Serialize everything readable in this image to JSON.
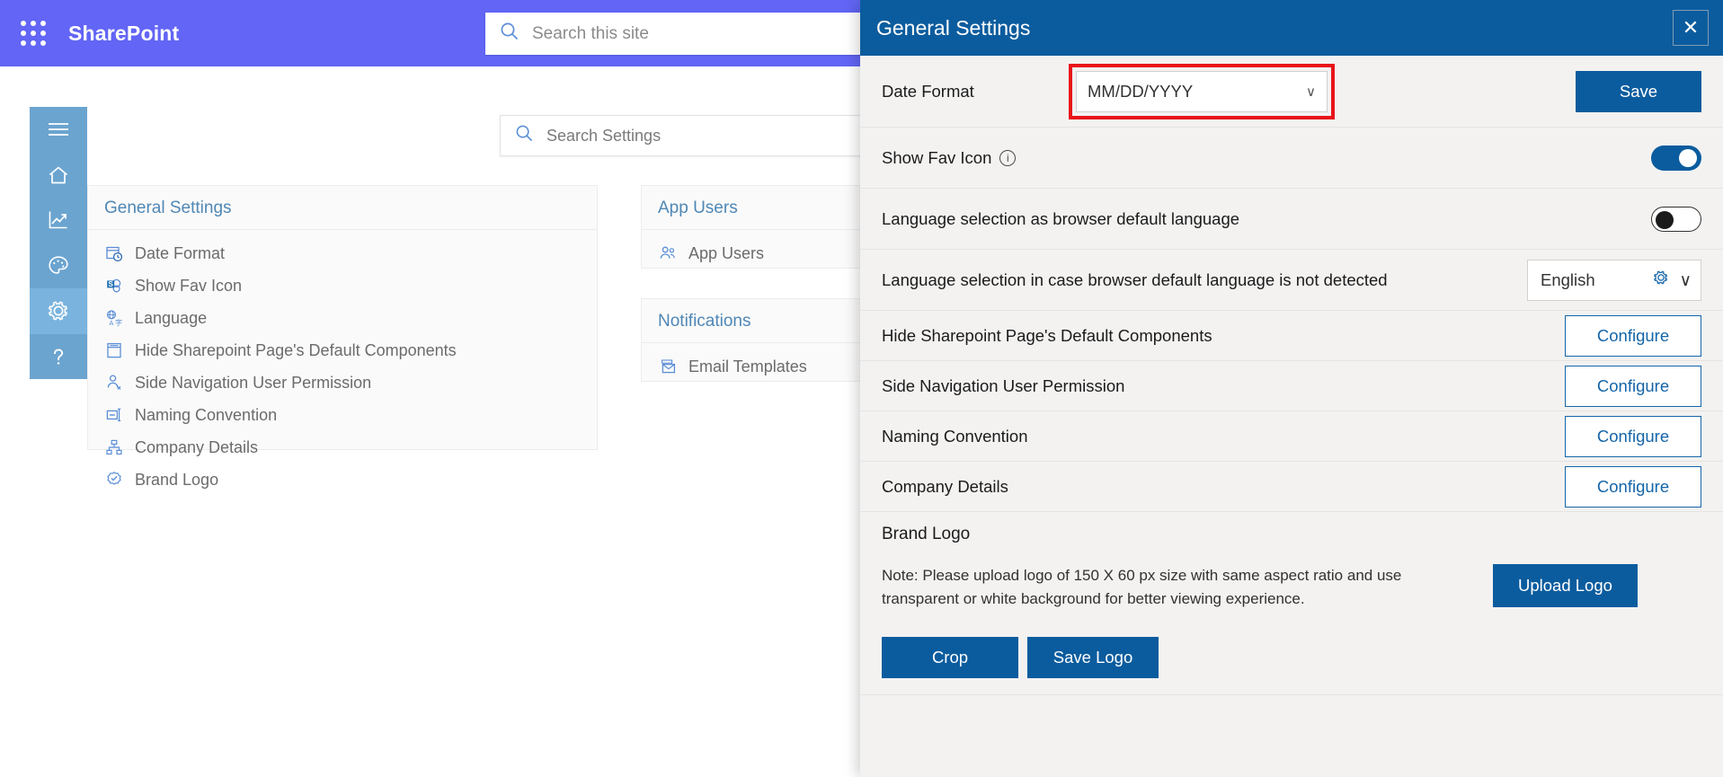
{
  "suitebar": {
    "waffle_label": "app-launcher",
    "brand": "SharePoint",
    "search_placeholder": "Search this site",
    "bg": "#6265f5"
  },
  "rail": {
    "items": [
      {
        "id": "menu",
        "icon": "hamburger-icon",
        "active": false
      },
      {
        "id": "home",
        "icon": "home-icon",
        "active": false
      },
      {
        "id": "reports",
        "icon": "chart-icon",
        "active": false
      },
      {
        "id": "theme",
        "icon": "palette-icon",
        "active": false
      },
      {
        "id": "settings",
        "icon": "gear-icon",
        "active": true
      },
      {
        "id": "help",
        "icon": "question-icon",
        "active": false
      }
    ],
    "bg": "#6ba4cf",
    "active_bg": "#79b3de"
  },
  "canvas": {
    "search_placeholder": "Search Settings",
    "groups": [
      {
        "title": "General Settings",
        "items": [
          {
            "label": "Date Format",
            "icon": "calendar-clock-icon"
          },
          {
            "label": "Show Fav Icon",
            "icon": "favicon-icon"
          },
          {
            "label": "Language",
            "icon": "language-icon"
          },
          {
            "label": "Hide Sharepoint Page's Default Components",
            "icon": "page-layout-icon"
          },
          {
            "label": "Side Navigation User Permission",
            "icon": "user-permission-icon"
          },
          {
            "label": "Naming Convention",
            "icon": "naming-icon"
          },
          {
            "label": "Company Details",
            "icon": "org-chart-icon"
          },
          {
            "label": "Brand Logo",
            "icon": "badge-icon"
          }
        ]
      },
      {
        "title": "App Users",
        "items": [
          {
            "label": "App Users",
            "icon": "people-icon"
          }
        ]
      },
      {
        "title": "Notifications",
        "items": [
          {
            "label": "Email Templates",
            "icon": "email-template-icon"
          }
        ]
      }
    ]
  },
  "panel": {
    "title": "General Settings",
    "close_label": "✕",
    "header_bg": "#0b5c9e",
    "highlight_color": "#e8151a",
    "rows": {
      "date_format": {
        "label": "Date Format",
        "value": "MM/DD/YYYY",
        "chevron": "∨",
        "save_label": "Save",
        "highlighted": true
      },
      "show_fav_icon": {
        "label": "Show Fav Icon",
        "info_glyph": "i",
        "toggle_state": "on"
      },
      "lang_browser_default": {
        "label": "Language selection as browser default language",
        "toggle_state": "off"
      },
      "lang_fallback": {
        "label": "Language selection in case browser default language is not detected",
        "value": "English",
        "chevron": "∨",
        "gear_icon": "gear-icon"
      },
      "configurables": [
        {
          "label": "Hide Sharepoint Page's Default Components",
          "button": "Configure"
        },
        {
          "label": "Side Navigation User Permission",
          "button": "Configure"
        },
        {
          "label": "Naming Convention",
          "button": "Configure"
        },
        {
          "label": "Company Details",
          "button": "Configure"
        }
      ],
      "brand_logo": {
        "heading": "Brand Logo",
        "note": "Note: Please upload logo of 150 X 60 px size with same aspect ratio and use transparent or white background for better viewing experience.",
        "upload_label": "Upload Logo",
        "crop_label": "Crop",
        "save_logo_label": "Save Logo"
      }
    }
  }
}
